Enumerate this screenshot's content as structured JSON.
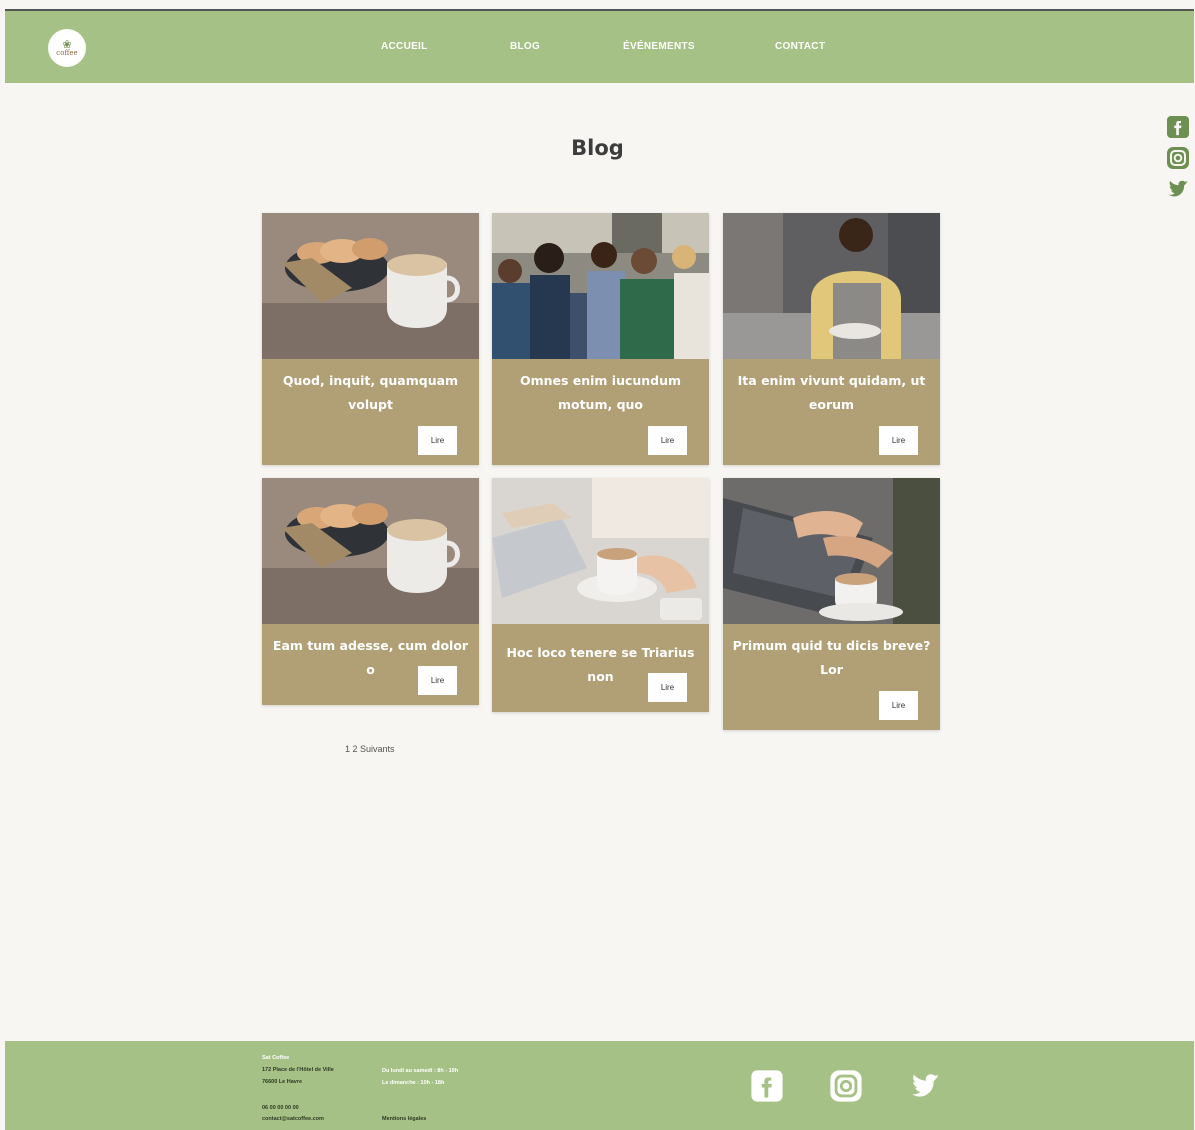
{
  "brand": {
    "logo_text": "coffee"
  },
  "nav": {
    "items": [
      {
        "label": "ACCUEIL"
      },
      {
        "label": "BLOG"
      },
      {
        "label": "ÉVÉNEMENTS"
      },
      {
        "label": "CONTACT"
      }
    ]
  },
  "side_social": {
    "icons": [
      "facebook-icon",
      "instagram-icon",
      "twitter-icon"
    ]
  },
  "page": {
    "title": "Blog"
  },
  "cards": [
    {
      "title": "Quod, inquit, quamquam volupt",
      "button": "Lire",
      "image": "croissants-and-coffee"
    },
    {
      "title": "Omnes enim iucundum motum, quo",
      "button": "Lire",
      "image": "friends-at-cafe"
    },
    {
      "title": "Ita enim vivunt quidam, ut eorum",
      "button": "Lire",
      "image": "smiling-barista"
    },
    {
      "title": "Eam tum adesse, cum dolor o",
      "button": "Lire",
      "image": "croissants-and-coffee"
    },
    {
      "title": "Hoc loco tenere se Triarius non",
      "button": "Lire",
      "image": "laptop-and-cappuccino"
    },
    {
      "title": "Primum quid tu dicis breve? Lor",
      "button": "Lire",
      "image": "typing-with-coffee"
    }
  ],
  "pagination": {
    "label": "1  2  Suivants"
  },
  "footer": {
    "name": "Sat Coffee",
    "address_line1": "172 Place de l'Hôtel de Ville",
    "address_line2": "76600 Le Havre",
    "phone": "06 00 00 00 00",
    "email": "contact@satcoffee.com",
    "hours_line1": "Du lundi au samedi : 8h - 19h",
    "hours_line2": "Le dimanche : 10h - 18h",
    "legal": "Mentions légales"
  },
  "colors": {
    "header_green": "#a5c185",
    "card_tan": "#b19f76",
    "background": "#f7f6f3"
  }
}
